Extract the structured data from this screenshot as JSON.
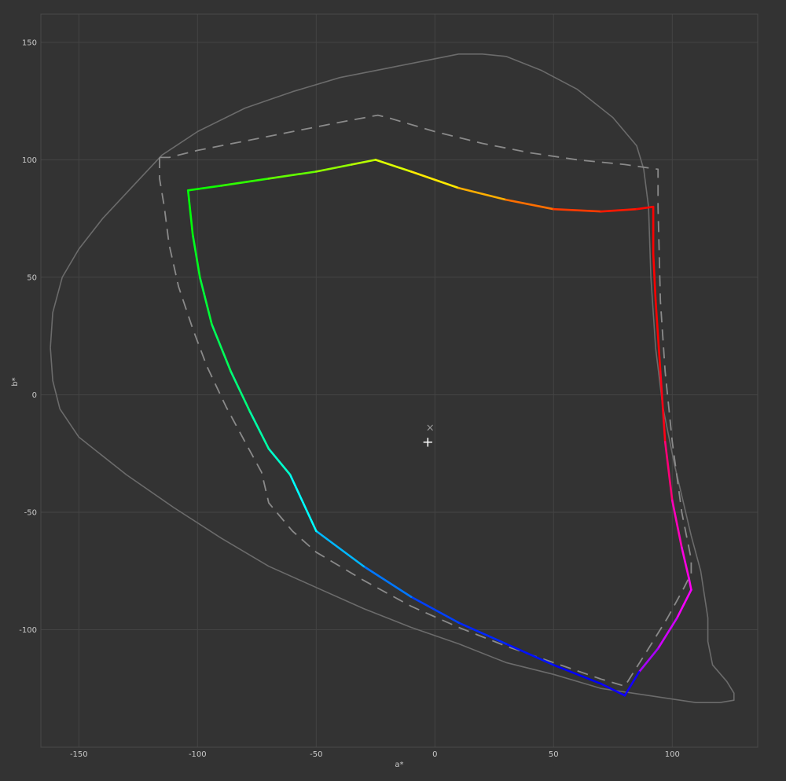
{
  "chart_data": {
    "type": "line",
    "title": "",
    "xlabel": "a*",
    "ylabel": "b*",
    "xlim": [
      -166,
      136
    ],
    "ylim": [
      -150,
      162
    ],
    "grid": true,
    "x_ticks": [
      -150,
      -100,
      -50,
      0,
      50,
      100
    ],
    "y_ticks": [
      150,
      100,
      50,
      0,
      -50,
      -100
    ],
    "colors": {
      "background": "#333333",
      "grid": "#444444",
      "locus": "#6b6b6b",
      "reference_gamut": "#8a8a8a",
      "white_point": "#ffffff",
      "reference_white": "#9a9a9a"
    },
    "series": [
      {
        "style": "solid-gray",
        "points": [
          [
            -162,
            20
          ],
          [
            -161,
            35
          ],
          [
            -157,
            50
          ],
          [
            -150,
            62
          ],
          [
            -140,
            75
          ],
          [
            -128,
            88
          ],
          [
            -115,
            102
          ],
          [
            -100,
            112
          ],
          [
            -80,
            122
          ],
          [
            -60,
            129
          ],
          [
            -40,
            135
          ],
          [
            -20,
            139
          ],
          [
            0,
            143
          ],
          [
            10,
            145
          ],
          [
            20,
            145
          ],
          [
            30,
            144
          ],
          [
            45,
            138
          ],
          [
            60,
            130
          ],
          [
            75,
            118
          ],
          [
            85,
            106
          ],
          [
            88,
            96
          ],
          [
            90,
            80
          ],
          [
            91,
            50
          ],
          [
            93,
            20
          ],
          [
            96,
            -5
          ],
          [
            101,
            -30
          ],
          [
            108,
            -60
          ],
          [
            112,
            -75
          ],
          [
            115,
            -95
          ],
          [
            115,
            -105
          ],
          [
            117,
            -115
          ],
          [
            123,
            -122
          ],
          [
            126,
            -127
          ],
          [
            126,
            -130
          ],
          [
            120,
            -131
          ],
          [
            110,
            -131
          ],
          [
            90,
            -128
          ],
          [
            70,
            -125
          ],
          [
            50,
            -119
          ],
          [
            30,
            -114
          ],
          [
            10,
            -106
          ],
          [
            -10,
            -99
          ],
          [
            -30,
            -91
          ],
          [
            -50,
            -82
          ],
          [
            -70,
            -73
          ],
          [
            -90,
            -61
          ],
          [
            -110,
            -48
          ],
          [
            -130,
            -34
          ],
          [
            -150,
            -18
          ],
          [
            -158,
            -6
          ],
          [
            -161,
            6
          ],
          [
            -162,
            20
          ]
        ]
      },
      {
        "style": "dashed-gray",
        "points": [
          [
            -116,
            101
          ],
          [
            -112,
            101
          ],
          [
            -100,
            104
          ],
          [
            -80,
            108
          ],
          [
            -60,
            112
          ],
          [
            -40,
            116
          ],
          [
            -24,
            119
          ],
          [
            -20,
            118
          ],
          [
            0,
            112
          ],
          [
            20,
            107
          ],
          [
            40,
            103
          ],
          [
            60,
            100
          ],
          [
            80,
            98
          ],
          [
            94,
            96
          ],
          [
            94,
            80
          ],
          [
            95,
            40
          ],
          [
            97,
            10
          ],
          [
            100,
            -20
          ],
          [
            104,
            -50
          ],
          [
            108,
            -70
          ],
          [
            108,
            -76
          ],
          [
            105,
            -82
          ],
          [
            98,
            -95
          ],
          [
            90,
            -108
          ],
          [
            80,
            -124
          ],
          [
            70,
            -121
          ],
          [
            50,
            -114
          ],
          [
            30,
            -107
          ],
          [
            10,
            -99
          ],
          [
            -10,
            -90
          ],
          [
            -30,
            -79
          ],
          [
            -50,
            -67
          ],
          [
            -60,
            -58
          ],
          [
            -70,
            -46
          ],
          [
            -73,
            -33
          ],
          [
            -80,
            -20
          ],
          [
            -88,
            -5
          ],
          [
            -96,
            12
          ],
          [
            -102,
            28
          ],
          [
            -108,
            46
          ],
          [
            -112,
            64
          ],
          [
            -114,
            80
          ],
          [
            -116,
            92
          ],
          [
            -116,
            101
          ]
        ]
      },
      {
        "style": "gradient-gamut",
        "points": [
          [
            -104,
            87
          ],
          [
            -90,
            89
          ],
          [
            -70,
            92
          ],
          [
            -50,
            95
          ],
          [
            -35,
            98
          ],
          [
            -25,
            100
          ],
          [
            -10,
            95
          ],
          [
            10,
            88
          ],
          [
            30,
            83
          ],
          [
            50,
            79
          ],
          [
            70,
            78
          ],
          [
            85,
            79
          ],
          [
            92,
            80
          ],
          [
            92,
            70
          ],
          [
            92,
            60
          ],
          [
            93,
            40
          ],
          [
            95,
            10
          ],
          [
            97,
            -20
          ],
          [
            100,
            -45
          ],
          [
            104,
            -65
          ],
          [
            107,
            -78
          ],
          [
            108,
            -83
          ],
          [
            102,
            -95
          ],
          [
            94,
            -108
          ],
          [
            86,
            -118
          ],
          [
            80,
            -128
          ],
          [
            70,
            -123
          ],
          [
            50,
            -115
          ],
          [
            30,
            -106
          ],
          [
            10,
            -97
          ],
          [
            -10,
            -86
          ],
          [
            -30,
            -73
          ],
          [
            -50,
            -58
          ],
          [
            -61,
            -34
          ],
          [
            -70,
            -23
          ],
          [
            -78,
            -7
          ],
          [
            -86,
            10
          ],
          [
            -94,
            30
          ],
          [
            -99,
            50
          ],
          [
            -102,
            68
          ],
          [
            -104,
            87
          ]
        ]
      }
    ],
    "markers": [
      {
        "symbol": "×",
        "x": -2,
        "y": -14
      },
      {
        "symbol": "+",
        "x": -3,
        "y": -20
      }
    ]
  }
}
